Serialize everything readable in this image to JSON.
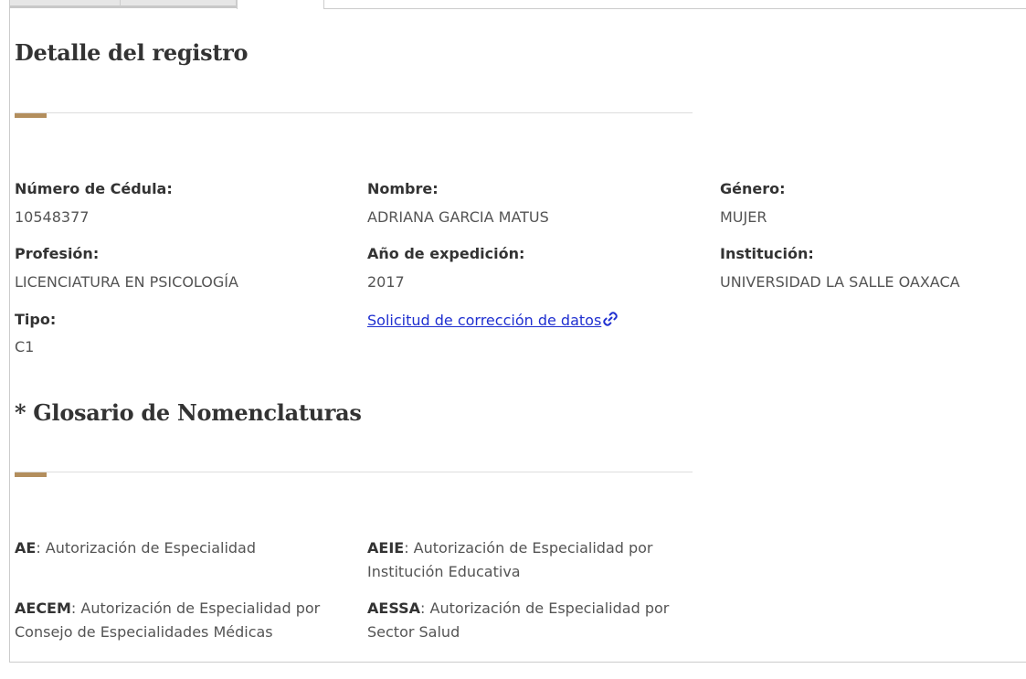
{
  "tabs": [
    "",
    "",
    ""
  ],
  "detail": {
    "title": "Detalle del registro",
    "fields": {
      "cedula_label": "Número de Cédula:",
      "cedula_value": "10548377",
      "nombre_label": "Nombre:",
      "nombre_value": "ADRIANA GARCIA MATUS",
      "genero_label": "Género:",
      "genero_value": "MUJER",
      "profesion_label": "Profesión:",
      "profesion_value": "LICENCIATURA EN PSICOLOGÍA",
      "anio_label": "Año de expedición:",
      "anio_value": "2017",
      "institucion_label": "Institución:",
      "institucion_value": "UNIVERSIDAD LA SALLE OAXACA",
      "tipo_label": "Tipo:",
      "tipo_value": "C1"
    },
    "correction_link": "Solicitud de corrección de datos",
    "correction_link_icon": "external-link-icon"
  },
  "glossary": {
    "title": "* Glosario de Nomenclaturas",
    "items": [
      {
        "abbr": "AE",
        "desc": ": Autorización de Especialidad"
      },
      {
        "abbr": "AEIE",
        "desc": ": Autorización de Especialidad por Institución Educativa"
      },
      {
        "abbr": "AECEM",
        "desc": ": Autorización de Especialidad por Consejo de Especialidades Médicas"
      },
      {
        "abbr": "AESSA",
        "desc": ": Autorización de Especialidad por Sector Salud"
      }
    ]
  },
  "colors": {
    "accent": "#b38e5d",
    "link": "#1f2fd0",
    "heading": "#333333",
    "text": "#545454"
  }
}
